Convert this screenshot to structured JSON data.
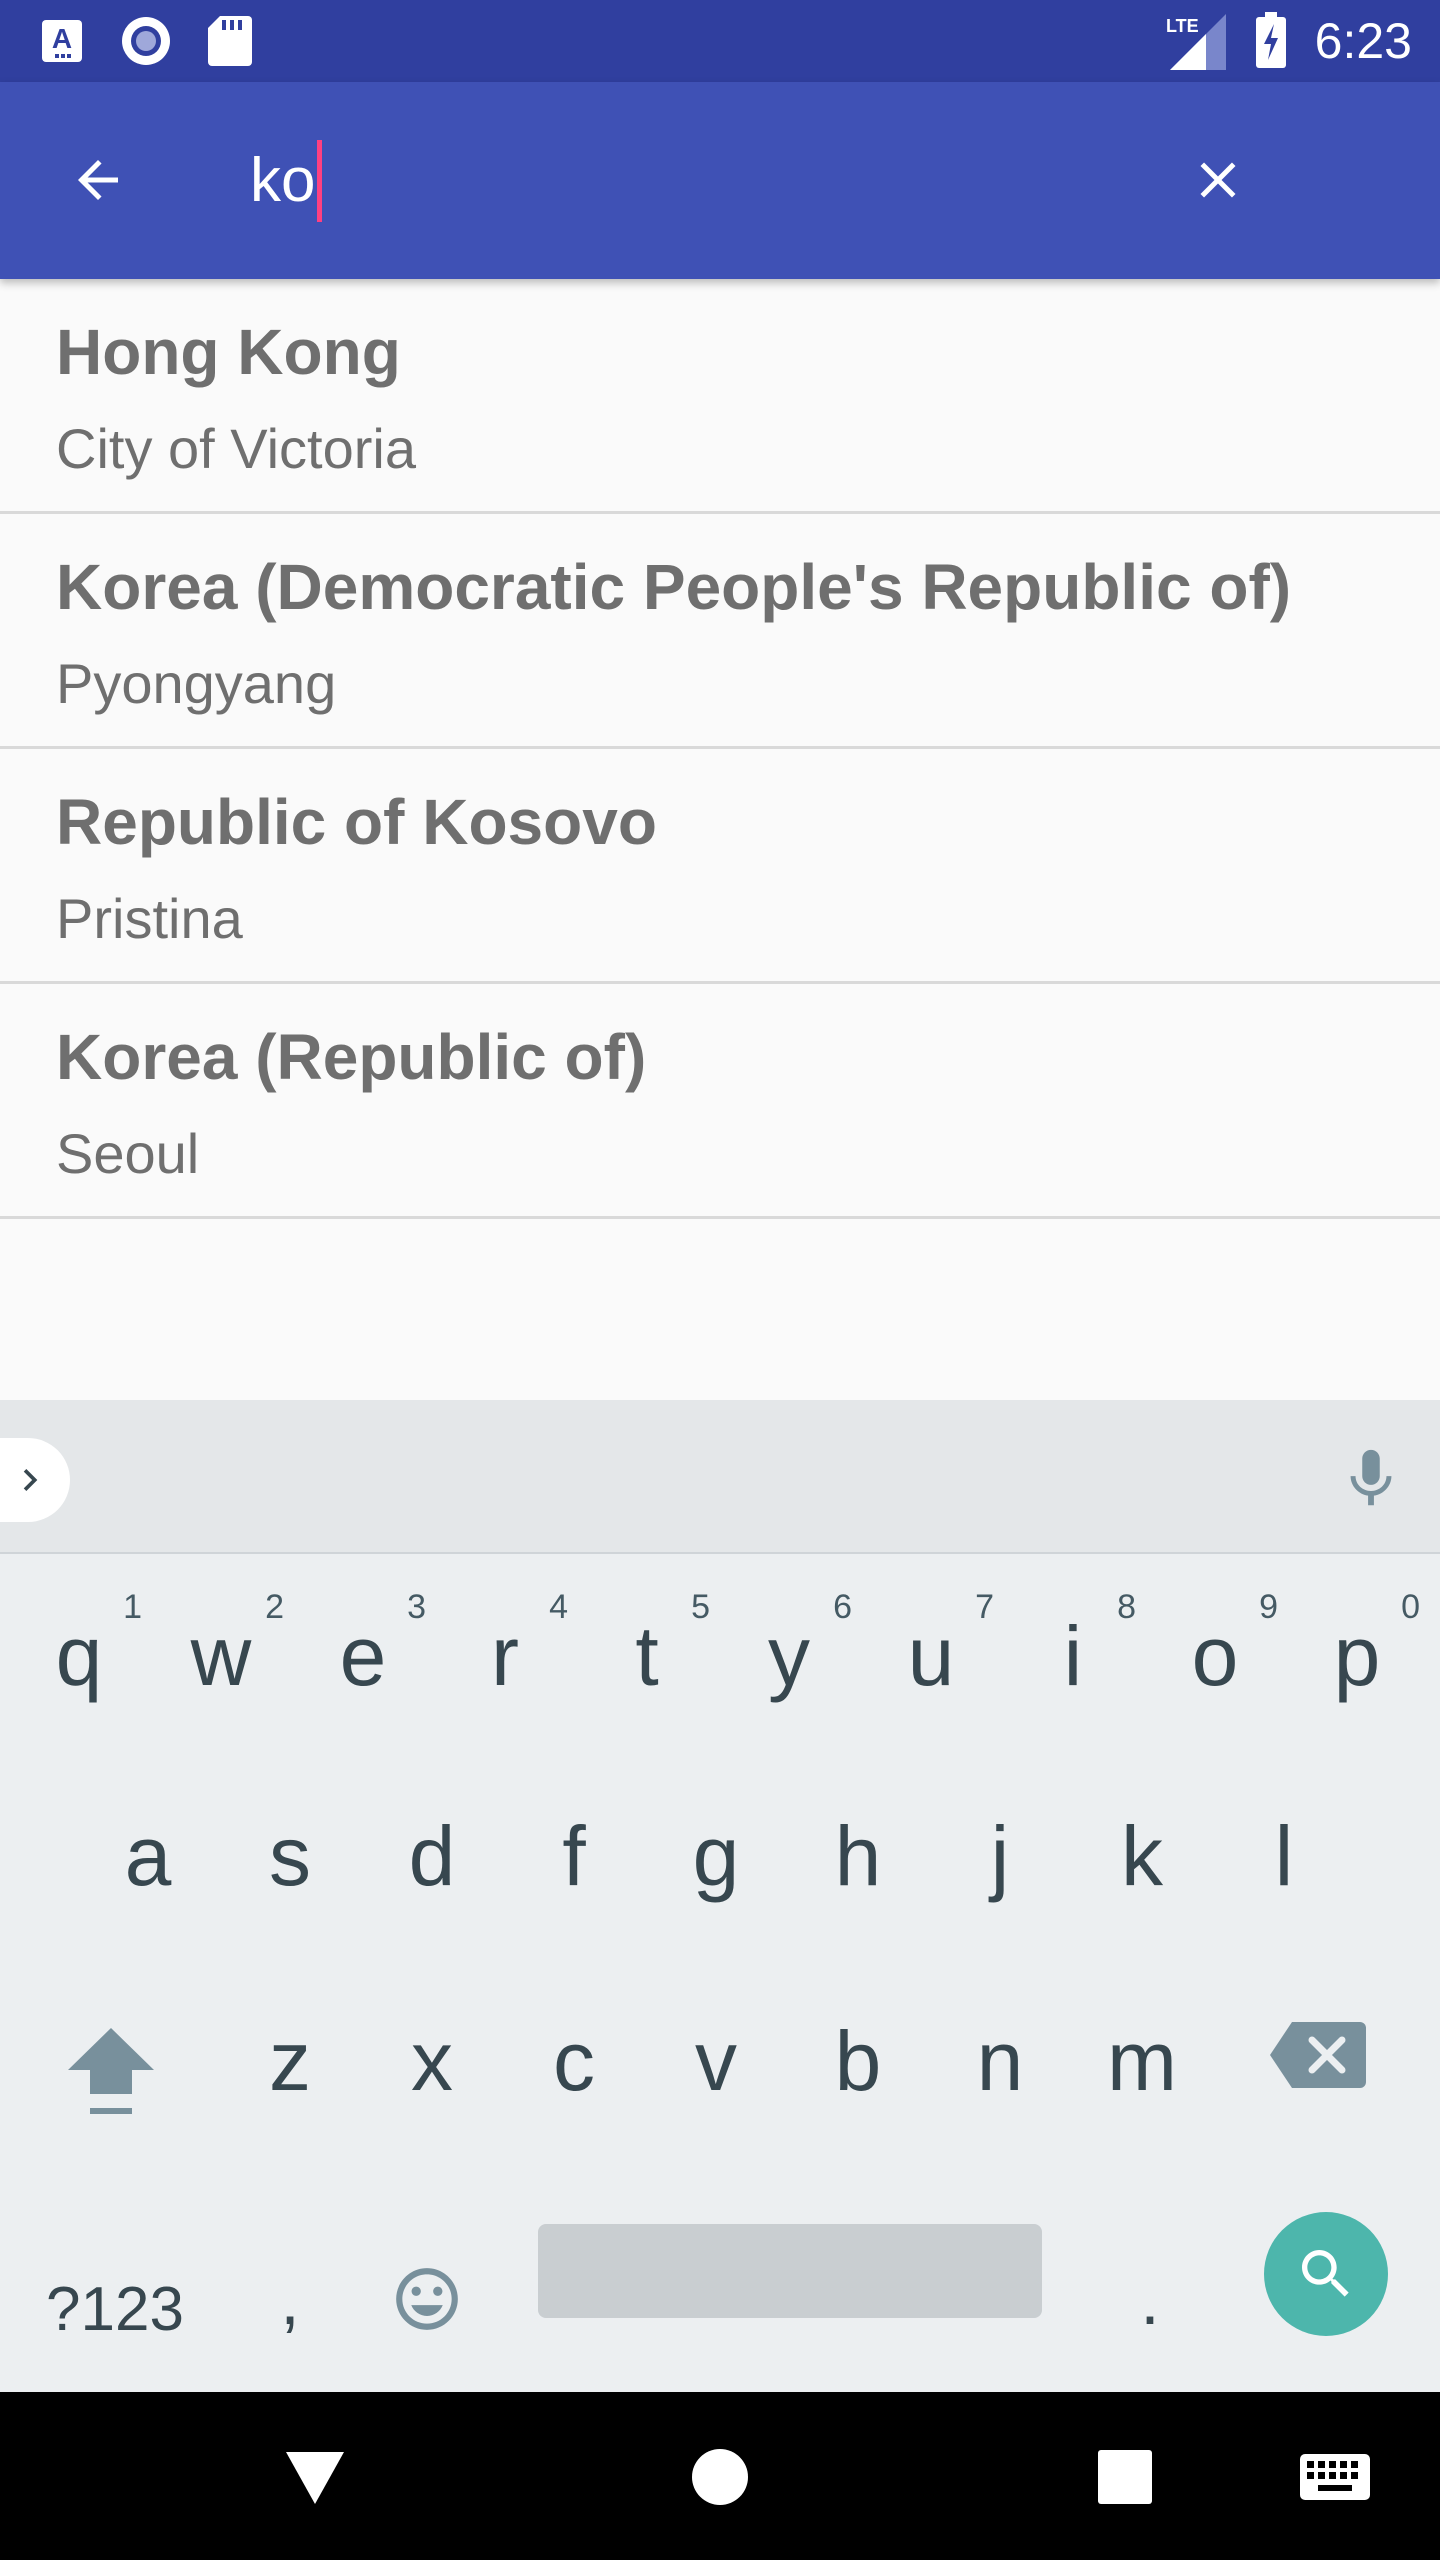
{
  "status_bar": {
    "time": "6:23",
    "network_label": "LTE",
    "icons": [
      "a-accessibility-icon",
      "record-icon",
      "sd-card-icon",
      "signal-icon",
      "battery-charging-icon"
    ]
  },
  "app_bar": {
    "search_value": "ko",
    "colors": {
      "primary": "#3f51b5",
      "primary_dark": "#303f9f",
      "caret": "#ff4081"
    }
  },
  "results": [
    {
      "name": "Hong Kong",
      "capital": "City of Victoria"
    },
    {
      "name": "Korea (Democratic People's Republic of)",
      "capital": "Pyongyang"
    },
    {
      "name": "Republic of Kosovo",
      "capital": "Pristina"
    },
    {
      "name": "Korea (Republic of)",
      "capital": "Seoul"
    }
  ],
  "keyboard": {
    "row1": [
      {
        "key": "q",
        "hint": "1"
      },
      {
        "key": "w",
        "hint": "2"
      },
      {
        "key": "e",
        "hint": "3"
      },
      {
        "key": "r",
        "hint": "4"
      },
      {
        "key": "t",
        "hint": "5"
      },
      {
        "key": "y",
        "hint": "6"
      },
      {
        "key": "u",
        "hint": "7"
      },
      {
        "key": "i",
        "hint": "8"
      },
      {
        "key": "o",
        "hint": "9"
      },
      {
        "key": "p",
        "hint": "0"
      }
    ],
    "row2": [
      "a",
      "s",
      "d",
      "f",
      "g",
      "h",
      "j",
      "k",
      "l"
    ],
    "row3": [
      "z",
      "x",
      "c",
      "v",
      "b",
      "n",
      "m"
    ],
    "symbols_label": "?123",
    "comma_label": ",",
    "period_label": ".",
    "action_color": "#4db6ac"
  }
}
